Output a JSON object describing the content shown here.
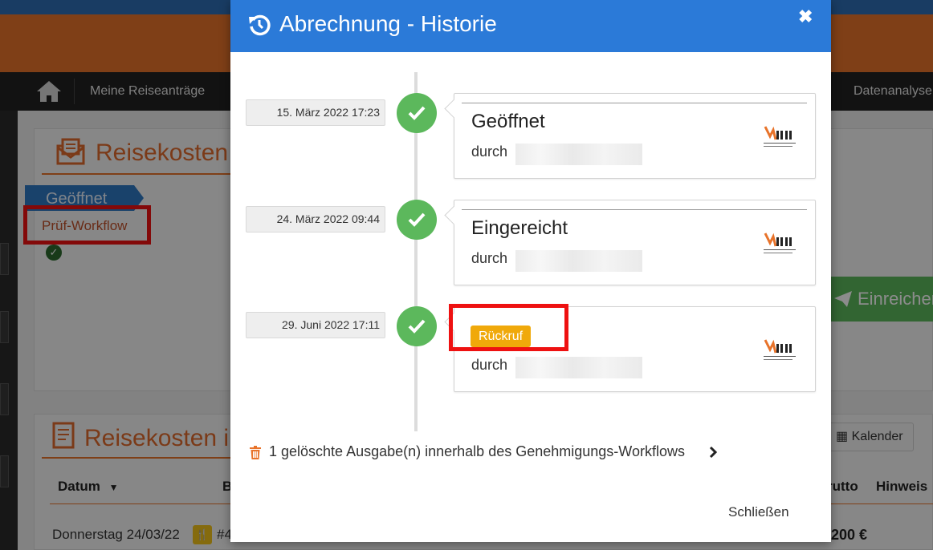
{
  "nav": {
    "items": [
      {
        "label": "Meine Reiseanträge"
      },
      {
        "label": "Datenanalyse"
      }
    ]
  },
  "page": {
    "section1_title": "Reisekosten",
    "status_label": "Geöffnet",
    "pruef_workflow_label": "Prüf-Workflow",
    "submit_button_label": "Einreichen",
    "section2_title": "Reisekosten i",
    "calendar_button_label": "Kalender",
    "table": {
      "headers": [
        "Datum",
        "B",
        "rutto",
        "Hinweis"
      ],
      "row": {
        "date": "Donnerstag 24/03/22",
        "number": "#4",
        "amount": "200 €"
      }
    }
  },
  "modal": {
    "title": "Abrechnung - Historie",
    "close_label": "Schließen",
    "events": [
      {
        "date": "15. März 2022 17:23",
        "title": "Geöffnet",
        "by_label": "durch"
      },
      {
        "date": "24. März 2022 09:44",
        "title": "Eingereicht",
        "by_label": "durch"
      },
      {
        "date": "29. Juni 2022 17:11",
        "badge": "Rückruf",
        "by_label": "durch"
      }
    ],
    "deleted_summary": "1 gelöschte Ausgabe(n) innerhalb des Genehmigungs-Workflows"
  },
  "colors": {
    "brand_orange": "#e8732a",
    "header_blue": "#2b7ad8",
    "success_green": "#5cb85c",
    "badge_amber": "#f0a90a",
    "highlight_red": "#ee1111"
  },
  "icons": {
    "home": "home-icon",
    "history": "history-icon",
    "check": "check-icon",
    "trash": "trash-icon",
    "chevron": "chevron-right-icon",
    "calendar": "calendar-icon",
    "send": "paper-plane-icon"
  }
}
